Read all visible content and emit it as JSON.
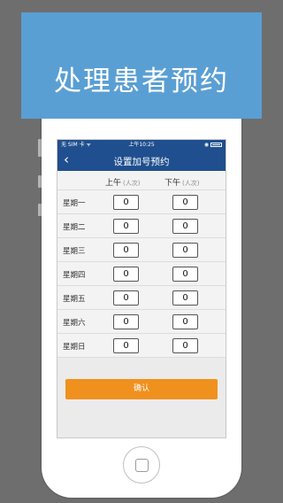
{
  "banner": {
    "title": "处理患者预约"
  },
  "status_bar": {
    "carrier": "无 SIM 卡 ᯤ",
    "time": "上午10:25",
    "right": "◉"
  },
  "nav": {
    "back_icon": "‹",
    "title": "设置加号预约"
  },
  "table": {
    "am_label": "上午",
    "pm_label": "下午",
    "unit": "(人次)",
    "rows": [
      {
        "day": "星期一",
        "am": "0",
        "pm": "0"
      },
      {
        "day": "星期二",
        "am": "0",
        "pm": "0"
      },
      {
        "day": "星期三",
        "am": "0",
        "pm": "0"
      },
      {
        "day": "星期四",
        "am": "0",
        "pm": "0"
      },
      {
        "day": "星期五",
        "am": "0",
        "pm": "0"
      },
      {
        "day": "星期六",
        "am": "0",
        "pm": "0"
      },
      {
        "day": "星期日",
        "am": "0",
        "pm": "0"
      }
    ]
  },
  "confirm_label": "确认",
  "colors": {
    "banner": "#5a9fd3",
    "nav": "#1f4f8e",
    "confirm": "#f0911e",
    "background": "#6e6e6e"
  }
}
